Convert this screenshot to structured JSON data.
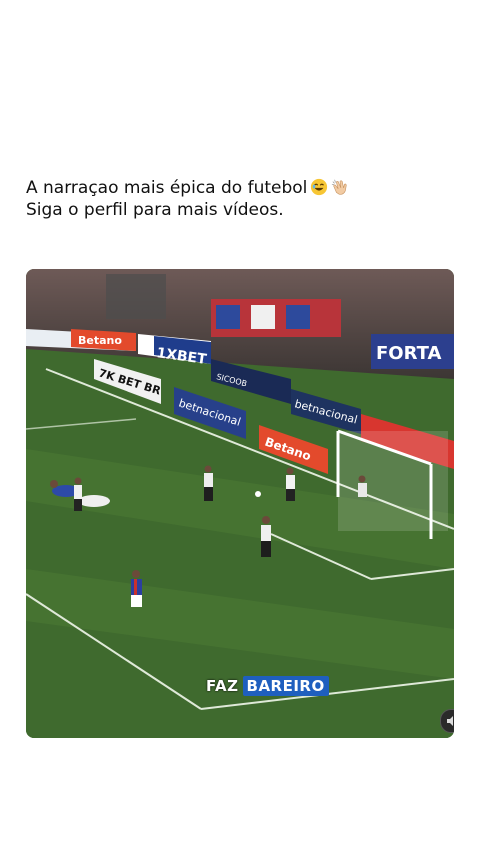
{
  "caption": {
    "line1": "A narraçao mais épica do futebol",
    "line2": "Siga o perfil para mais vídeos."
  },
  "icons": {
    "caption_emoji_1": "laughing-face-emoji",
    "caption_emoji_2": "clapping-hands-emoji",
    "video_corner": "mute-speaker-icon"
  },
  "video": {
    "subtitle_part1": "FAZ",
    "subtitle_part2": "BAREIRO",
    "ads": {
      "betano": "Betano",
      "ixbet": "1XBET",
      "betsul": "7K BET BR",
      "betnacional": "betnacional",
      "sicoob": "SICOOB",
      "banner_fortaleza": "FORTA"
    }
  },
  "colors": {
    "pitch": "#3f6a2e",
    "pitch_stripe": "#4a7733",
    "subtitle_highlight": "#1f5fbf",
    "betano_orange": "#e34a2c"
  }
}
